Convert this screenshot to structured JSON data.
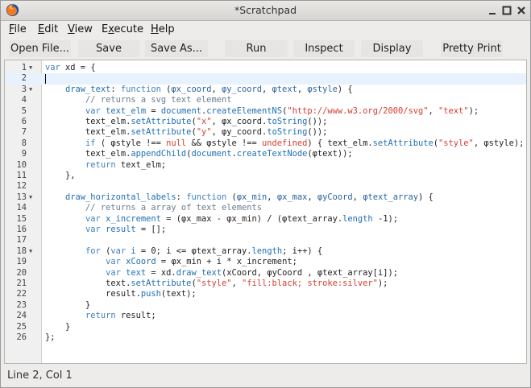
{
  "window": {
    "title": "*Scratchpad"
  },
  "menu": [
    {
      "label": "File",
      "mnemonic": "F"
    },
    {
      "label": "Edit",
      "mnemonic": "E"
    },
    {
      "label": "View",
      "mnemonic": "V"
    },
    {
      "label": "Execute",
      "mnemonic": "x"
    },
    {
      "label": "Help",
      "mnemonic": "H"
    }
  ],
  "toolbar": [
    {
      "label": "Open File..."
    },
    {
      "label": "Save"
    },
    {
      "label": "Save As..."
    },
    {
      "label": "Run"
    },
    {
      "label": "Inspect"
    },
    {
      "label": "Display"
    },
    {
      "label": "Pretty Print"
    }
  ],
  "editor": {
    "active_line": 2,
    "fold_lines": [
      1,
      3,
      13,
      18
    ],
    "lines": [
      [
        [
          "kw",
          "var"
        ],
        [
          "t",
          " xd = {"
        ]
      ],
      [],
      [
        [
          "t",
          "    "
        ],
        [
          "fn",
          "draw_text"
        ],
        [
          "t",
          ": "
        ],
        [
          "kw",
          "function"
        ],
        [
          "t",
          " ("
        ],
        [
          "pr",
          "φx_coord"
        ],
        [
          "t",
          ", "
        ],
        [
          "pr",
          "φy_coord"
        ],
        [
          "t",
          ", "
        ],
        [
          "pr",
          "φtext"
        ],
        [
          "t",
          ", "
        ],
        [
          "pr",
          "φstyle"
        ],
        [
          "t",
          ") {"
        ]
      ],
      [
        [
          "t",
          "        "
        ],
        [
          "cmt",
          "// returns a svg text element"
        ]
      ],
      [
        [
          "t",
          "        "
        ],
        [
          "kw",
          "var"
        ],
        [
          "t",
          " "
        ],
        [
          "fn",
          "text_elm"
        ],
        [
          "t",
          " = "
        ],
        [
          "fn",
          "document"
        ],
        [
          "t",
          "."
        ],
        [
          "fn",
          "createElementNS"
        ],
        [
          "t",
          "("
        ],
        [
          "str",
          "\"http://www.w3.org/2000/svg\""
        ],
        [
          "t",
          ", "
        ],
        [
          "str",
          "\"text\""
        ],
        [
          "t",
          ");"
        ]
      ],
      [
        [
          "t",
          "        text_elm."
        ],
        [
          "fn",
          "setAttribute"
        ],
        [
          "t",
          "("
        ],
        [
          "str",
          "\"x\""
        ],
        [
          "t",
          ", φx_coord."
        ],
        [
          "fn",
          "toString"
        ],
        [
          "t",
          "());"
        ]
      ],
      [
        [
          "t",
          "        text_elm."
        ],
        [
          "fn",
          "setAttribute"
        ],
        [
          "t",
          "("
        ],
        [
          "str",
          "\"y\""
        ],
        [
          "t",
          ", φy_coord."
        ],
        [
          "fn",
          "toString"
        ],
        [
          "t",
          "());"
        ]
      ],
      [
        [
          "t",
          "        "
        ],
        [
          "kw",
          "if"
        ],
        [
          "t",
          " ( φstyle !== "
        ],
        [
          "str",
          "null"
        ],
        [
          "t",
          " && φstyle !== "
        ],
        [
          "str",
          "undefined"
        ],
        [
          "t",
          ") { text_elm."
        ],
        [
          "fn",
          "setAttribute"
        ],
        [
          "t",
          "("
        ],
        [
          "str",
          "\"style\""
        ],
        [
          "t",
          ", φstyle); }"
        ]
      ],
      [
        [
          "t",
          "        text_elm."
        ],
        [
          "fn",
          "appendChild"
        ],
        [
          "t",
          "("
        ],
        [
          "fn",
          "document"
        ],
        [
          "t",
          "."
        ],
        [
          "fn",
          "createTextNode"
        ],
        [
          "t",
          "(φtext));"
        ]
      ],
      [
        [
          "t",
          "        "
        ],
        [
          "kw",
          "return"
        ],
        [
          "t",
          " text_elm;"
        ]
      ],
      [
        [
          "t",
          "    },"
        ]
      ],
      [],
      [
        [
          "t",
          "    "
        ],
        [
          "fn",
          "draw_horizontal_labels"
        ],
        [
          "t",
          ": "
        ],
        [
          "kw",
          "function"
        ],
        [
          "t",
          " ("
        ],
        [
          "pr",
          "φx_min"
        ],
        [
          "t",
          ", "
        ],
        [
          "pr",
          "φx_max"
        ],
        [
          "t",
          ", "
        ],
        [
          "pr",
          "φyCoord"
        ],
        [
          "t",
          ", "
        ],
        [
          "pr",
          "φtext_array"
        ],
        [
          "t",
          ") {"
        ]
      ],
      [
        [
          "t",
          "        "
        ],
        [
          "cmt",
          "// returns a array of text elements"
        ]
      ],
      [
        [
          "t",
          "        "
        ],
        [
          "kw",
          "var"
        ],
        [
          "t",
          " "
        ],
        [
          "fn",
          "x_increment"
        ],
        [
          "t",
          " = (φx_max - φx_min) / (φtext_array."
        ],
        [
          "fn",
          "length"
        ],
        [
          "t",
          " -1);"
        ]
      ],
      [
        [
          "t",
          "        "
        ],
        [
          "kw",
          "var"
        ],
        [
          "t",
          " "
        ],
        [
          "fn",
          "result"
        ],
        [
          "t",
          " = [];"
        ]
      ],
      [],
      [
        [
          "t",
          "        "
        ],
        [
          "kw",
          "for"
        ],
        [
          "t",
          " ("
        ],
        [
          "kw",
          "var"
        ],
        [
          "t",
          " "
        ],
        [
          "fn",
          "i"
        ],
        [
          "t",
          " = 0; i <= φtext_array."
        ],
        [
          "fn",
          "length"
        ],
        [
          "t",
          "; i++) {"
        ]
      ],
      [
        [
          "t",
          "            "
        ],
        [
          "kw",
          "var"
        ],
        [
          "t",
          " "
        ],
        [
          "fn",
          "xCoord"
        ],
        [
          "t",
          " = φx_min + i * x_increment;"
        ]
      ],
      [
        [
          "t",
          "            "
        ],
        [
          "kw",
          "var"
        ],
        [
          "t",
          " "
        ],
        [
          "fn",
          "text"
        ],
        [
          "t",
          " = xd."
        ],
        [
          "fn",
          "draw_text"
        ],
        [
          "t",
          "(xCoord, φyCoord , φtext_array[i]);"
        ]
      ],
      [
        [
          "t",
          "            text."
        ],
        [
          "fn",
          "setAttribute"
        ],
        [
          "t",
          "("
        ],
        [
          "str",
          "\"style\""
        ],
        [
          "t",
          ", "
        ],
        [
          "str",
          "\"fill:black; stroke:silver\""
        ],
        [
          "t",
          ");"
        ]
      ],
      [
        [
          "t",
          "            result."
        ],
        [
          "fn",
          "push"
        ],
        [
          "t",
          "(text);"
        ]
      ],
      [
        [
          "t",
          "        }"
        ]
      ],
      [
        [
          "t",
          "        "
        ],
        [
          "kw",
          "return"
        ],
        [
          "t",
          " result;"
        ]
      ],
      [
        [
          "t",
          "    }"
        ]
      ],
      [
        [
          "t",
          "};"
        ]
      ]
    ]
  },
  "status": {
    "text": "Line 2, Col 1"
  },
  "icons": {
    "app": "firefox-logo-icon",
    "minimize": "minimize-icon",
    "maximize": "maximize-icon",
    "close": "close-icon",
    "fold": "fold-arrow-icon"
  }
}
